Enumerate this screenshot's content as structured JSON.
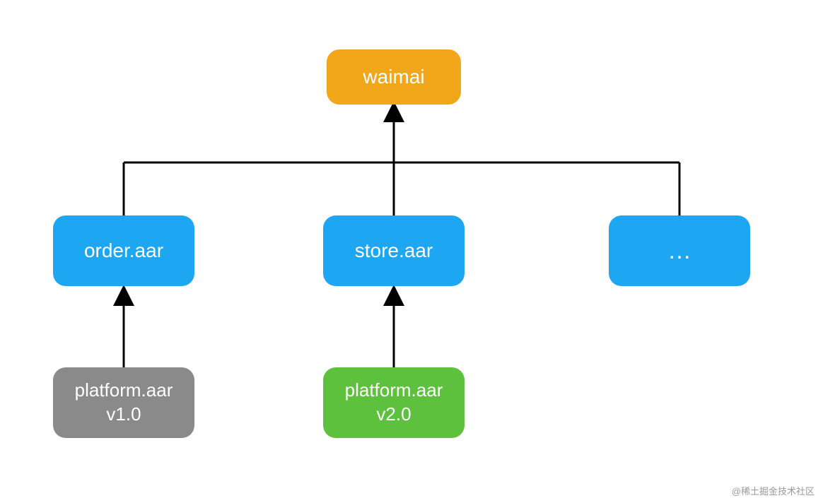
{
  "nodes": {
    "root": {
      "label": "waimai",
      "color": "#f2a71b"
    },
    "order": {
      "label": "order.aar",
      "color": "#1da6f2"
    },
    "store": {
      "label": "store.aar",
      "color": "#1da6f2"
    },
    "more": {
      "label": "…",
      "color": "#1da6f2"
    },
    "platform_v1": {
      "line1": "platform.aar",
      "line2": "v1.0",
      "color": "#8a8a8a"
    },
    "platform_v2": {
      "line1": "platform.aar",
      "line2": "v2.0",
      "color": "#5ec13e"
    }
  },
  "watermark": "@稀土掘金技术社区"
}
